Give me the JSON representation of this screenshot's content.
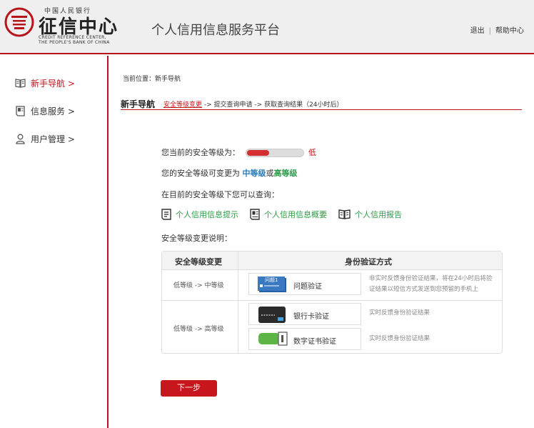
{
  "header": {
    "logo_top": "中国人民银行",
    "logo_name": "征信中心",
    "logo_en_line1": "CREDIT REFERENCE CENTER,",
    "logo_en_line2": "THE PEOPLE'S BANK OF CHINA",
    "platform_title": "个人信用信息服务平台",
    "logout": "退出",
    "separator": "|",
    "help": "帮助中心",
    "brand_color": "#b8141b"
  },
  "sidebar": {
    "items": [
      {
        "label": "新手导航 >",
        "icon": "book-icon",
        "active": true
      },
      {
        "label": "信息服务 >",
        "icon": "document-icon",
        "active": false
      },
      {
        "label": "用户管理 >",
        "icon": "user-icon",
        "active": false
      }
    ]
  },
  "main": {
    "breadcrumb": "当前位置：新手导航",
    "guide_title": "新手导航",
    "steps": {
      "step1": "安全等级变更",
      "arrow1": " -> ",
      "step2": "提交查询申请",
      "arrow2": " -> ",
      "step3": "获取查询结果",
      "note": "（24小时后）"
    },
    "current_level_label": "您当前的安全等级为：",
    "current_level_value": "低",
    "current_level_fraction": 0.4,
    "changeable_prefix": "您的安全等级可变更为 ",
    "level_mid": "中等级",
    "level_or": "或",
    "level_high": "高等级",
    "query_intro": "在目前的安全等级下您可以查询：",
    "query_links": [
      {
        "label": "个人信用信息提示",
        "icon": "report-icon"
      },
      {
        "label": "个人信用信息概要",
        "icon": "summary-icon"
      },
      {
        "label": "个人信用报告",
        "icon": "open-book-icon"
      }
    ],
    "change_desc_label": "安全等级变更说明：",
    "table": {
      "header_change": "安全等级变更",
      "header_method": "身份验证方式",
      "row1_change": "低等级 -> 中等级",
      "row2_change": "低等级 -> 高等级",
      "method_question": "问题验证",
      "question_card_text": "问题1",
      "method_bank": "银行卡验证",
      "method_cert": "数字证书验证",
      "desc_question": "非实时反馈身份验证结果，将在24小时后将验证结果以短信方式发送到您预留的手机上",
      "desc_bank": "实时反馈身份验证结果",
      "desc_cert": "实时反馈身份验证结果"
    },
    "next_button": "下一步"
  }
}
